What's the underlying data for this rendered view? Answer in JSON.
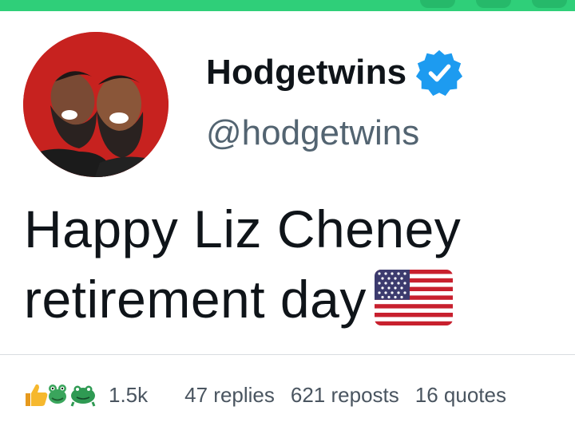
{
  "profile": {
    "display_name": "Hodgetwins",
    "handle": "@hodgetwins",
    "verified": true,
    "avatar_icon": "profile-photo"
  },
  "tweet": {
    "text_line1": "Happy Liz Cheney",
    "text_line2": "retirement day",
    "emoji": "us-flag"
  },
  "stats": {
    "reaction_icons": [
      "thumbs-up-icon",
      "frog-icon",
      "frog-icon"
    ],
    "reaction_count": "1.5k",
    "replies": "47 replies",
    "reposts": "621 reposts",
    "quotes": "16 quotes"
  },
  "colors": {
    "top_bar": "#2fcf79",
    "verified_badge": "#1d9bf0",
    "text": "#0f1419",
    "secondary_text": "#536471"
  }
}
